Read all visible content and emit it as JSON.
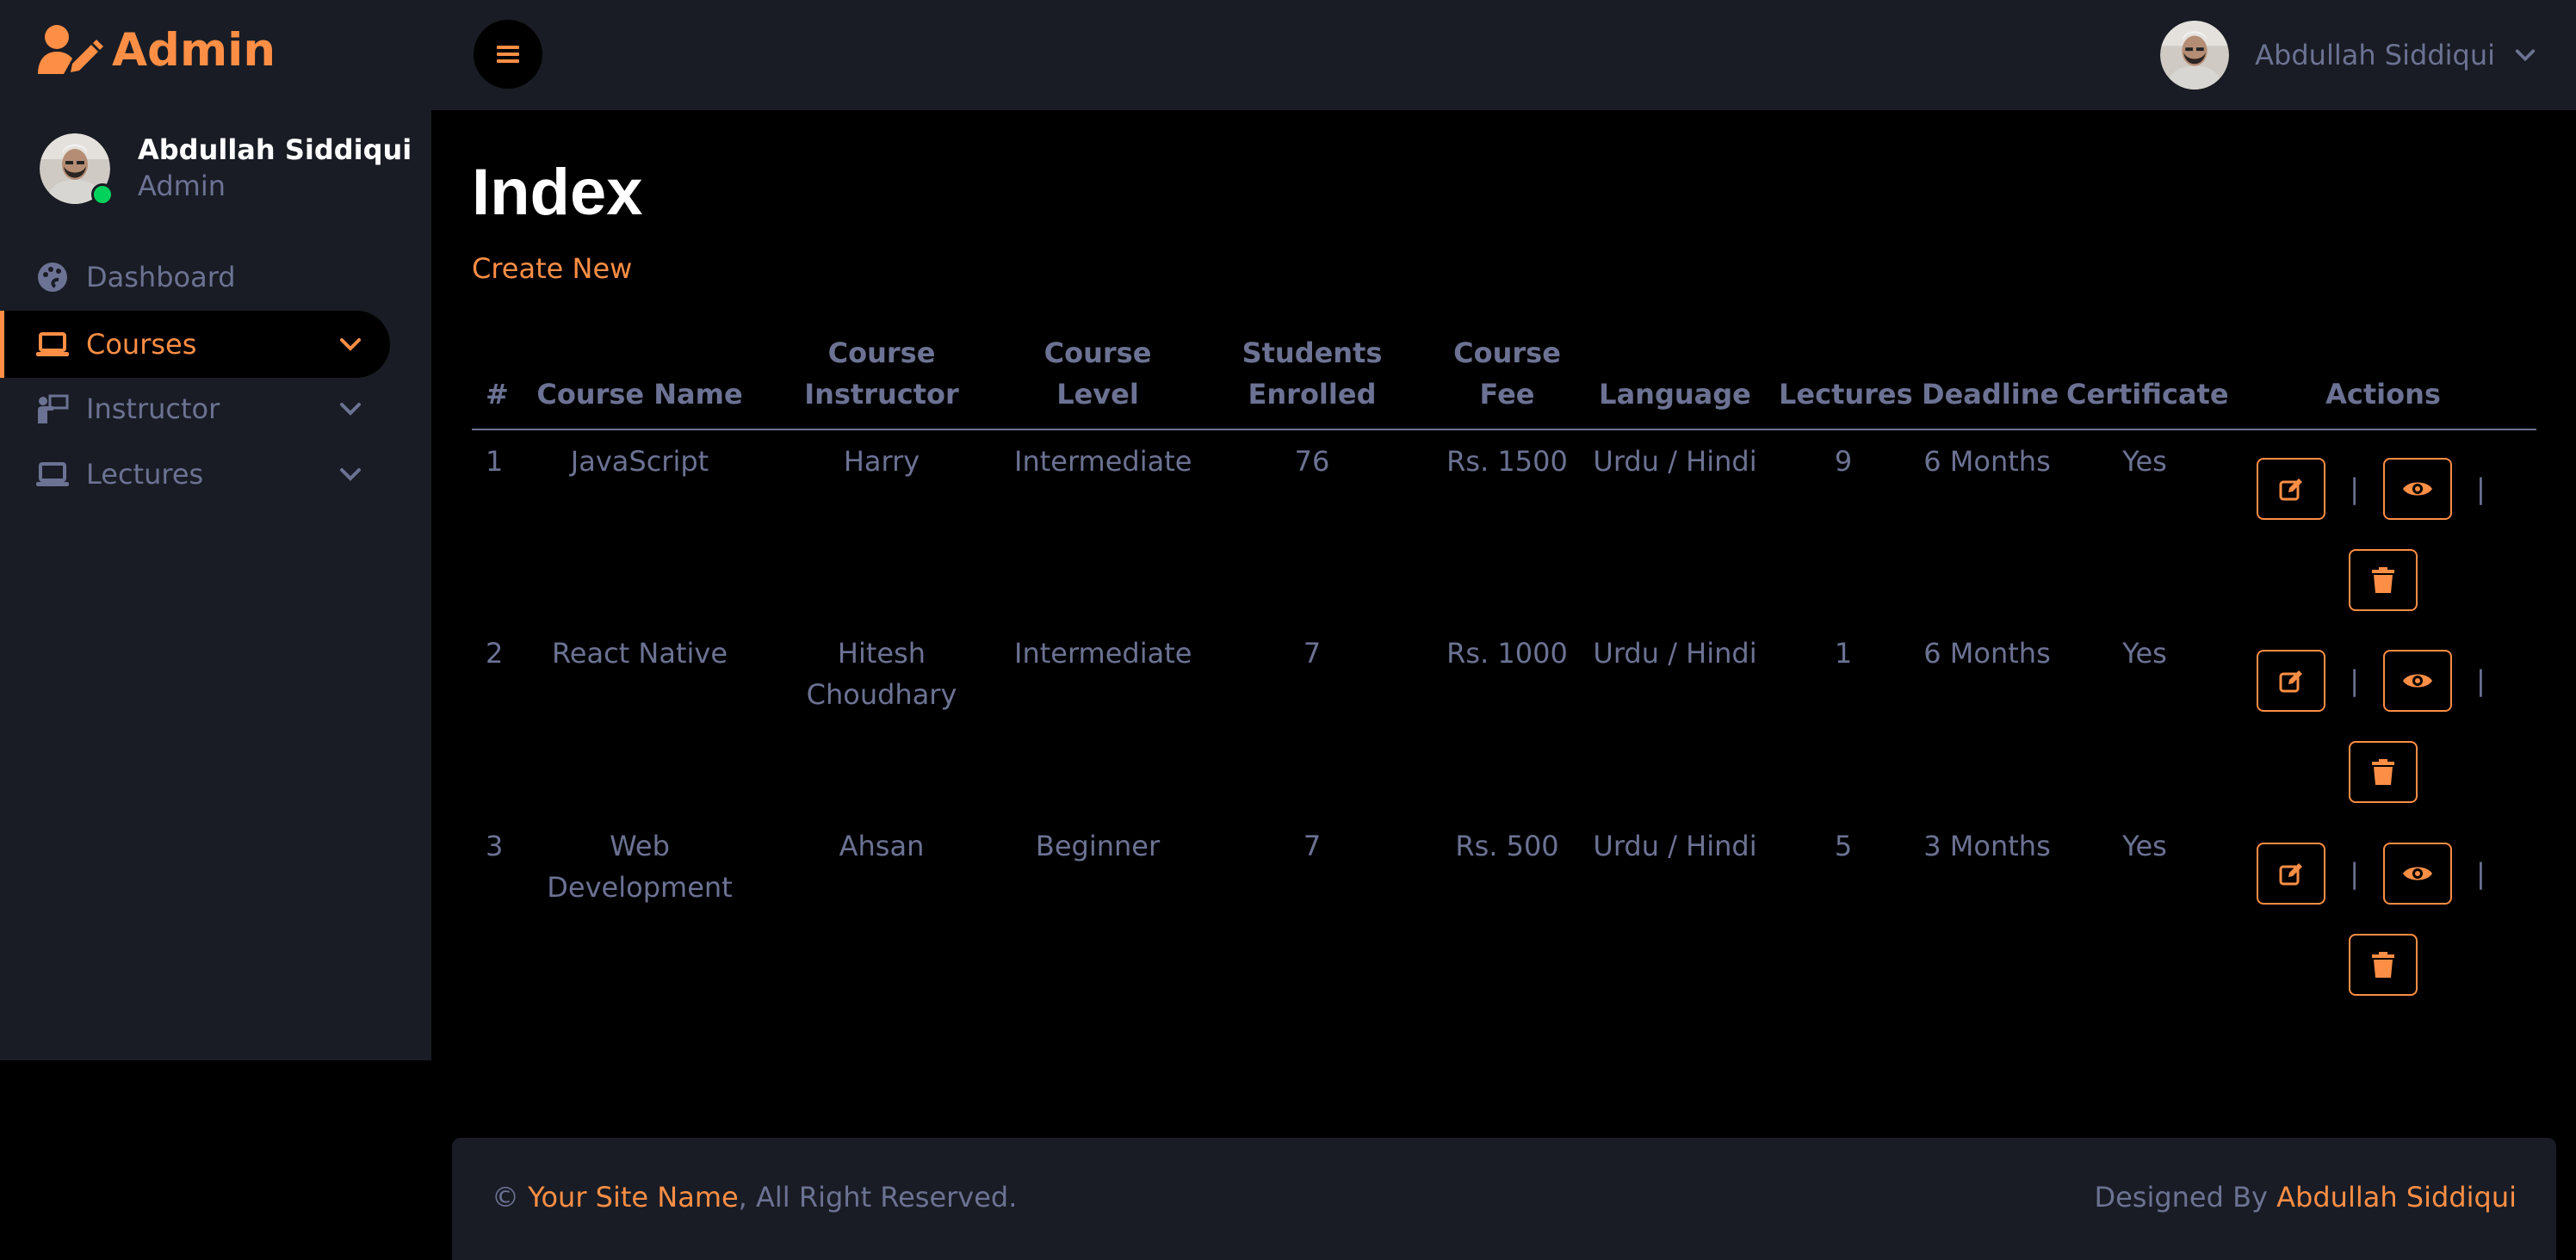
{
  "brand": {
    "title": "Admin",
    "icon": "user-edit-icon"
  },
  "profile": {
    "name": "Abdullah Siddiqui",
    "role": "Admin"
  },
  "sidebar": {
    "items": [
      {
        "label": "Dashboard",
        "icon": "palette-icon",
        "active": false,
        "dropdown": false
      },
      {
        "label": "Courses",
        "icon": "laptop-icon",
        "active": true,
        "dropdown": true
      },
      {
        "label": "Instructor",
        "icon": "chalkboard-teacher-icon",
        "active": false,
        "dropdown": true
      },
      {
        "label": "Lectures",
        "icon": "laptop-icon",
        "active": false,
        "dropdown": true
      }
    ]
  },
  "header": {
    "user_name": "Abdullah Siddiqui"
  },
  "main": {
    "title": "Index",
    "create_link": "Create New",
    "columns": [
      "#",
      "Course Name",
      "Course Instructor",
      "Course Level",
      "Students Enrolled",
      "Course Fee",
      "Language",
      "Lectures",
      "Deadline",
      "Certificate",
      "Actions"
    ],
    "rows": [
      {
        "num": "1",
        "name": "JavaScript",
        "instructor": "Harry",
        "level": "Intermediate",
        "students": "76",
        "fee": "Rs. 1500",
        "language": "Urdu / Hindi",
        "lectures": "9",
        "deadline": "6 Months",
        "certificate": "Yes"
      },
      {
        "num": "2",
        "name": "React Native",
        "instructor": "Hitesh Choudhary",
        "level": "Intermediate",
        "students": "7",
        "fee": "Rs. 1000",
        "language": "Urdu / Hindi",
        "lectures": "1",
        "deadline": "6 Months",
        "certificate": "Yes"
      },
      {
        "num": "3",
        "name": "Web Development",
        "instructor": "Ahsan",
        "level": "Beginner",
        "students": "7",
        "fee": "Rs. 500",
        "language": "Urdu / Hindi",
        "lectures": "5",
        "deadline": "3 Months",
        "certificate": "Yes"
      }
    ],
    "action_separator": "|"
  },
  "footer": {
    "copyright_symbol": "©",
    "site_name": "Your Site Name",
    "rights": ", All Right Reserved.",
    "designed_by": "Designed By",
    "designer": "Abdullah Siddiqui"
  },
  "colors": {
    "accent": "#fc8e45",
    "sidebar_bg": "#191c24",
    "page_bg": "#000000",
    "muted_text": "#6c7293",
    "online": "#00d25b"
  }
}
